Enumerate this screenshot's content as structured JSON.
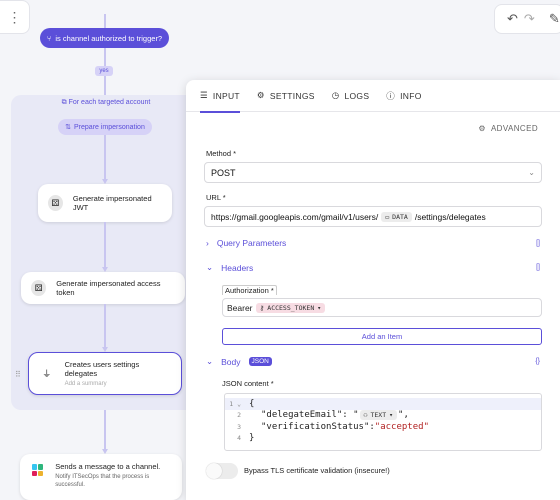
{
  "topbar": {
    "menu_icon": "⋮",
    "undo_icon": "↶",
    "redo_icon": "↷",
    "wand_icon": "✎"
  },
  "flow": {
    "condition_label": "is channel authorized to trigger?",
    "yes_label": "yes",
    "loop_title": "For each targeted account",
    "prepare_label": "Prepare impersonation",
    "node1_label": "Generate impersonated JWT",
    "node2_label": "Generate impersonated access token",
    "node3_label": "Creates users settings delegates",
    "node3_sub": "Add a summary",
    "node4_label": "Sends a message to a channel.",
    "node4_desc": "Notify ITSecOps that the process is successful.",
    "accent": "#5b4fd9"
  },
  "panel": {
    "tabs": [
      "INPUT",
      "SETTINGS",
      "LOGS",
      "INFO"
    ],
    "advanced_label": "ADVANCED",
    "method_label": "Method *",
    "method_value": "POST",
    "url_label": "URL *",
    "url_prefix": "https://gmail.googleapis.com/gmail/v1/users/",
    "url_chip": "DATA",
    "url_suffix": "/settings/delegates",
    "query_params_label": "Query Parameters",
    "query_params_tail": "[]",
    "headers_label": "Headers",
    "headers_tail": "[]",
    "auth_label": "Authorization *",
    "auth_prefix": "Bearer",
    "auth_chip": "ACCESS_TOKEN",
    "add_item_label": "Add an Item",
    "body_label": "Body",
    "body_badge": "JSON",
    "body_tail": "{}",
    "json_label": "JSON content *",
    "code": {
      "l1": "{",
      "l2_key": "\"delegateEmail\": \"",
      "l2_chip": "TEXT",
      "l2_end": "\",",
      "l3_key": "\"verificationStatus\": ",
      "l3_val": "\"accepted\"",
      "l4": "}"
    },
    "tls_label": "Bypass TLS certificate validation (insecure!)"
  }
}
